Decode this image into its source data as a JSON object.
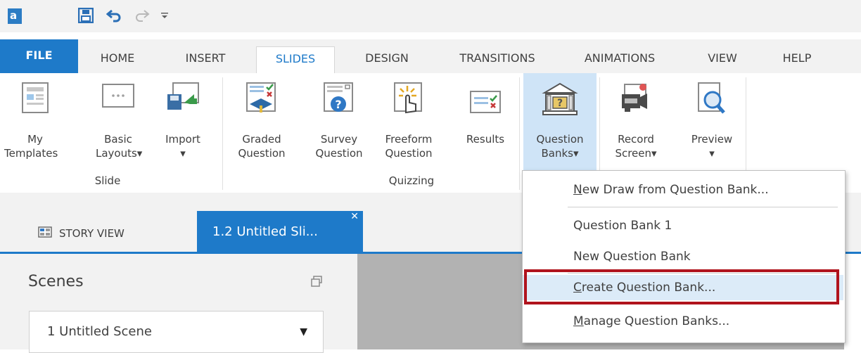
{
  "tabs": [
    "FILE",
    "HOME",
    "INSERT",
    "SLIDES",
    "DESIGN",
    "TRANSITIONS",
    "ANIMATIONS",
    "VIEW",
    "HELP"
  ],
  "active_tab": "SLIDES",
  "ribbon": {
    "slide_group": {
      "label": "Slide",
      "my_templates": [
        "My",
        "Templates"
      ],
      "basic_layouts": [
        "Basic",
        "Layouts▾"
      ],
      "import": [
        "Import",
        "▾"
      ]
    },
    "quizzing_group": {
      "label": "Quizzing",
      "graded_question": [
        "Graded",
        "Question"
      ],
      "survey_question": [
        "Survey",
        "Question"
      ],
      "freeform_question": [
        "Freeform",
        "Question"
      ],
      "results": [
        "Results"
      ]
    },
    "question_banks": [
      "Question",
      "Banks▾"
    ],
    "record_screen": [
      "Record",
      "Screen▾"
    ],
    "preview": [
      "Preview",
      "▾"
    ]
  },
  "story_view_label": "STORY VIEW",
  "slide_tab_label": "1.2 Untitled Sli...",
  "scenes": {
    "title": "Scenes",
    "selected": "1 Untitled Scene"
  },
  "menu": {
    "items": [
      {
        "prefix": "",
        "underline": "N",
        "rest": "ew Draw from Question Bank..."
      },
      {
        "prefix": "",
        "underline": "",
        "rest": "Question Bank 1"
      },
      {
        "prefix": "",
        "underline": "",
        "rest": "New Question Bank"
      },
      {
        "prefix": "",
        "underline": "C",
        "rest": "reate Question Bank..."
      },
      {
        "prefix": "",
        "underline": "M",
        "rest": "anage Question Banks..."
      }
    ]
  },
  "colors": {
    "accent": "#1e7ac9",
    "highlight": "#cfe4f7",
    "callout": "#b0131d",
    "canvas": "#b2b2b2"
  }
}
